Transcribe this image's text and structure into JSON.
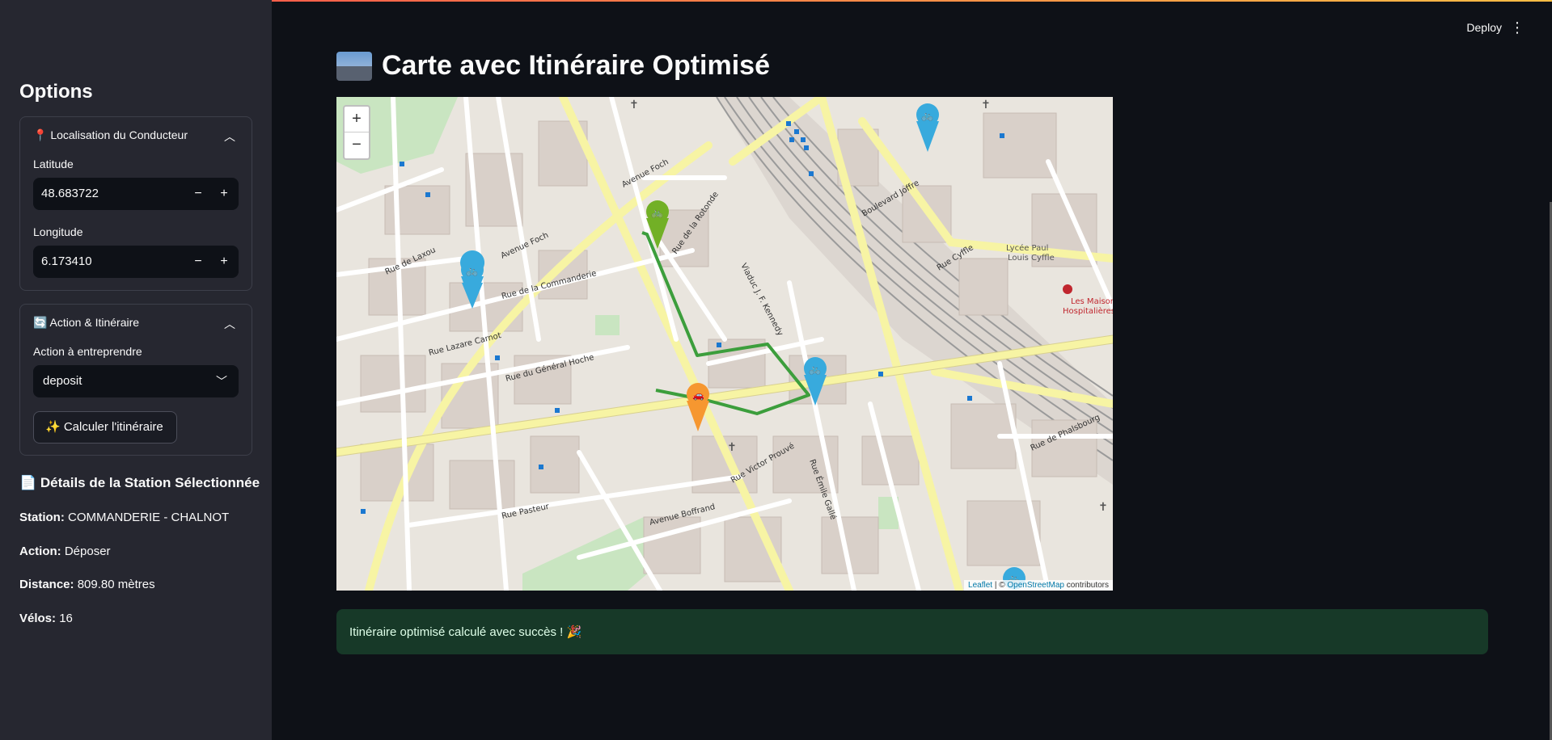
{
  "header": {
    "deploy_label": "Deploy",
    "menu_icon": "kebab-icon"
  },
  "sidebar": {
    "title": "Options",
    "location": {
      "header": "📍 Localisation du Conducteur",
      "latitude_label": "Latitude",
      "latitude_value": "48.683722",
      "longitude_label": "Longitude",
      "longitude_value": "6.173410",
      "minus": "−",
      "plus": "+"
    },
    "action": {
      "header": "🔄 Action & Itinéraire",
      "select_label": "Action à entreprendre",
      "select_value": "deposit",
      "button_label": "✨ Calculer l'itinéraire"
    },
    "details": {
      "title": "📄 Détails de la Station Sélectionnée",
      "station_label": "Station:",
      "station_value": "COMMANDERIE - CHALNOT",
      "action_label": "Action:",
      "action_value": "Déposer",
      "distance_label": "Distance:",
      "distance_value": "809.80 mètres",
      "velos_label": "Vélos:",
      "velos_value": "16"
    }
  },
  "main": {
    "title": "Carte avec Itinéraire Optimisé",
    "map": {
      "zoom_in": "+",
      "zoom_out": "−",
      "attribution_leaflet": "Leaflet",
      "attribution_sep": " | © ",
      "attribution_osm": "OpenStreetMap",
      "attribution_tail": " contributors",
      "street_labels": [
        "Avenue Foch",
        "Rue de Laxou",
        "Rue de la Commanderie",
        "Rue Lazare Carnot",
        "Rue du Général Hoche",
        "Boulevard Joffre",
        "Rue Cyffle",
        "Viaduc J. F. Kennedy",
        "Rue Victor Prouvé",
        "Rue Pasteur",
        "Avenue Boffrand",
        "Rue de Phalsbourg",
        "Lycée Paul Louis Cyffle",
        "Les Maisons Hospitalières",
        "Rue de la Rotonde",
        "Rue Émile Gallé"
      ]
    },
    "success_message": "Itinéraire optimisé calculé avec succès ! 🎉"
  },
  "colors": {
    "route": "#3c9e3c",
    "station_blue": "#38aadd",
    "station_green": "#72b026",
    "driver_orange": "#f69730",
    "success_bg": "#173928"
  }
}
